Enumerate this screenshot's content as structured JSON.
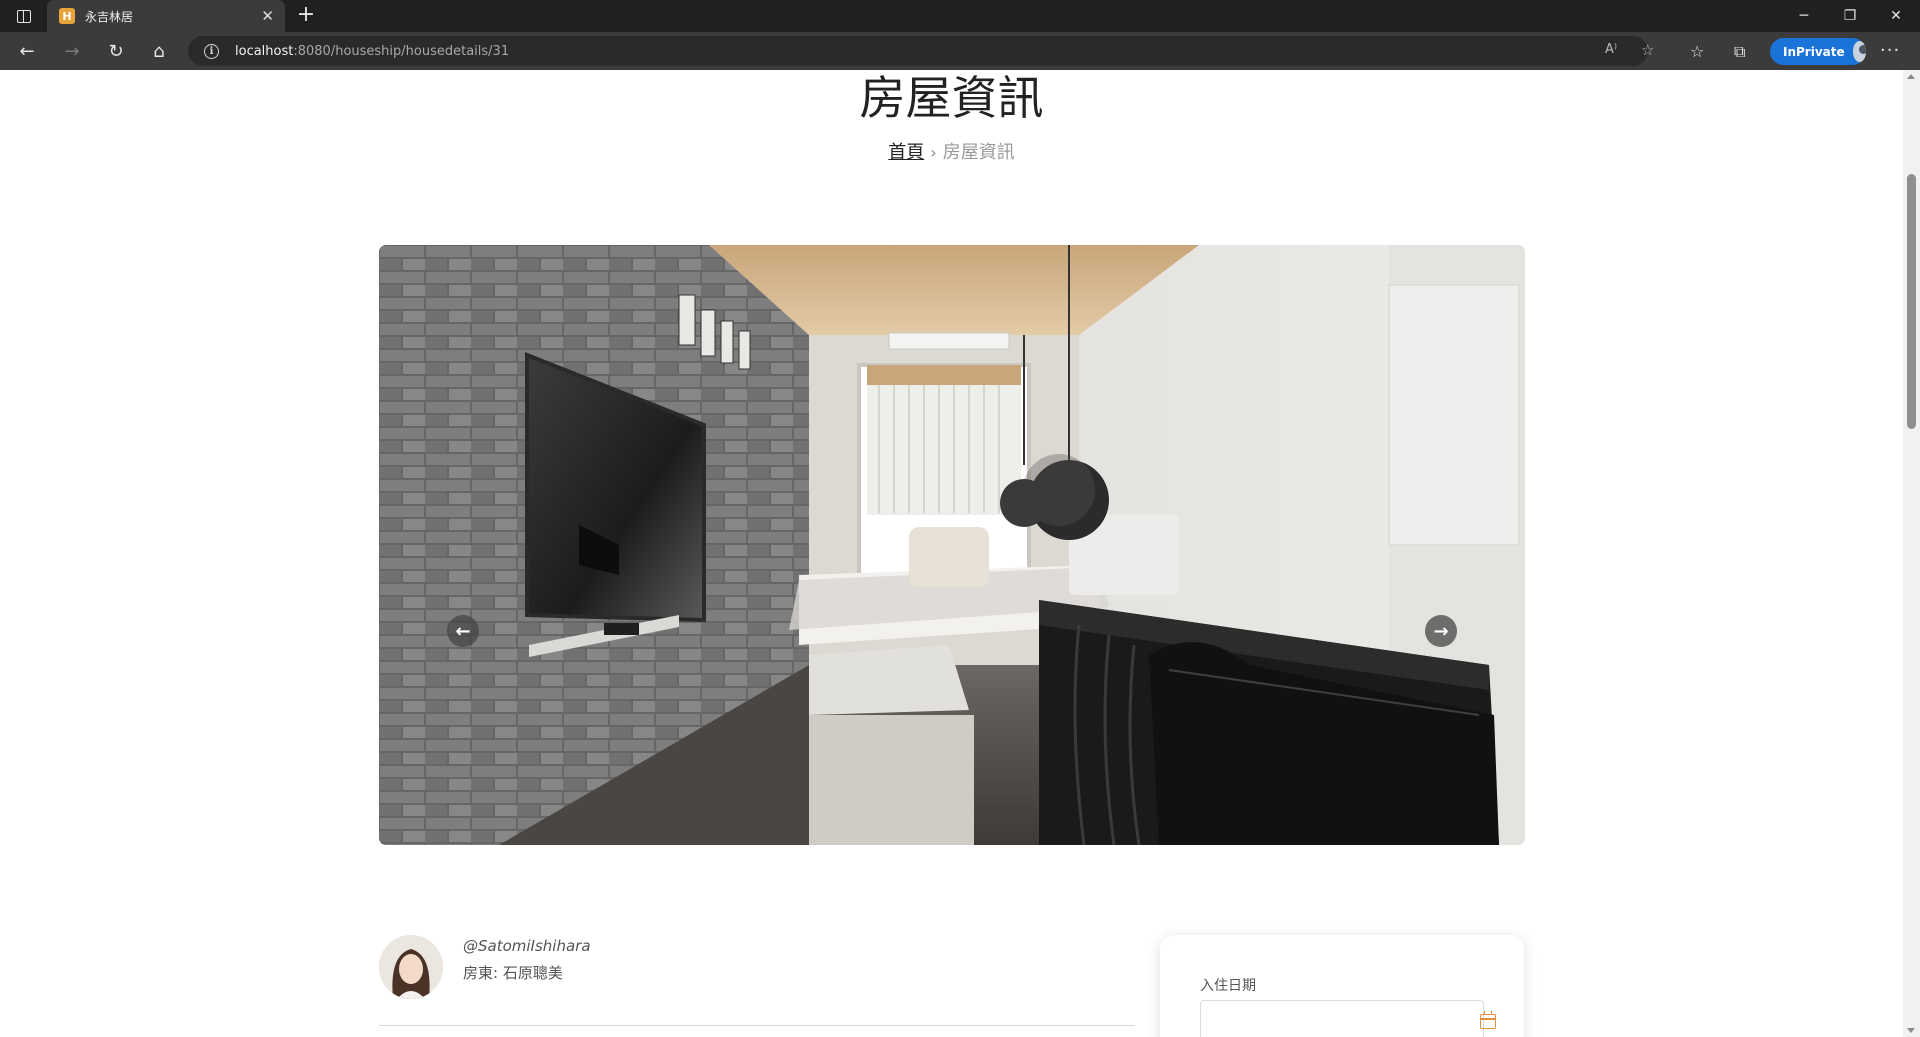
{
  "browser": {
    "tab_title": "永吉林居",
    "favicon_letter": "H",
    "url_host": "localhost",
    "url_rest": ":8080/houseship/housedetails/31",
    "inprivate_label": "InPrivate",
    "accent": "#1a73d9"
  },
  "page": {
    "title": "房屋資訊",
    "breadcrumb": {
      "home": "首頁",
      "separator": "›",
      "current": "房屋資訊"
    }
  },
  "carousel": {
    "prev_icon": "arrow-left-icon",
    "next_icon": "arrow-right-icon",
    "prev_glyph": "←",
    "next_glyph": "→"
  },
  "host": {
    "handle": "@SatomiIshihara",
    "name": "房東: 石原聰美"
  },
  "booking": {
    "checkin_label": "入住日期",
    "checkin_value": "",
    "icon": "calendar-icon",
    "icon_color": "#e0903a"
  }
}
